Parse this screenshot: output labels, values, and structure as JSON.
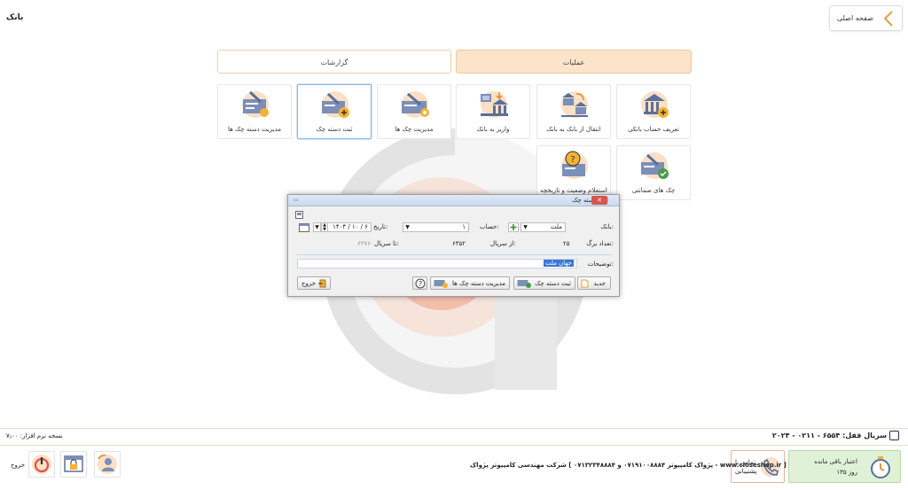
{
  "page": {
    "title": "بانک",
    "home_label": "صفحه اصلی"
  },
  "tabs": {
    "operations": "عملیات",
    "reports": "گزارشات"
  },
  "tiles": [
    {
      "label": "تعریف حساب بانکی",
      "icon": "bank-add-icon"
    },
    {
      "label": "انتقال از بانک به بانک",
      "icon": "bank-transfer-icon"
    },
    {
      "label": "واریز به بانک",
      "icon": "bank-deposit-icon"
    },
    {
      "label": "مدیریت چک ها",
      "icon": "cheque-manage-icon"
    },
    {
      "label": "ثبت دسته چک",
      "icon": "cheque-book-add-icon"
    },
    {
      "label": "مدیریت دسته چک ها",
      "icon": "cheque-book-manage-icon"
    },
    {
      "label": "چک های ضمانتی",
      "icon": "guarantee-cheque-icon"
    },
    {
      "label": "استعلام وضعیت و تاریخچه",
      "icon": "inquiry-icon"
    }
  ],
  "dialog": {
    "title": "ثبت دسته چک",
    "bank_label": "بانک:",
    "bank_value": "ملت",
    "account_label": "حساب:",
    "account_value": "۱",
    "date_label": "تاریخ:",
    "date_value": "۱۴۰۴ / ۱۰ / ۶",
    "sheets_label": "تعداد برگ:",
    "sheets_value": "۲۵",
    "from_serial_label": "از سریال:",
    "from_serial_value": "۶۳۵۲",
    "to_serial_label": "تا سریال:",
    "to_serial_value": "۶۳۷۶",
    "desc_label": "توضیحات:",
    "desc_value": "جهان ملت",
    "btn_new": "جدید",
    "btn_save": "ثبت دسته چک",
    "btn_manage": "مدیریت دسته چک ها",
    "btn_exit": "خروج"
  },
  "footer": {
    "version": "نسخه نرم افزار: ۷٫۰۰",
    "serial": "سریال قفل: ۶۵۵۴ - ۰۲۱۱ - ۲۰۲۴",
    "credit_line1": "اعتبار باقی مانده",
    "credit_line2": "۱۳۵ روز",
    "support_line1": "تماس با",
    "support_line2": "پشتیبانی",
    "company": "شرکت مهندسی کامپیوتر پژواک [ پژواک کامپیوتر ۰۷۱۹۱۰۰۸۸۸۴ و ۰۷۱۳۲۳۴۸۸۸۴ - www.closeshop.ir ]",
    "exit": "خروج"
  },
  "colors": {
    "accent": "#f5b76a",
    "tab_active": "#fbe4c9",
    "credit_bg": "#dff2d8"
  }
}
